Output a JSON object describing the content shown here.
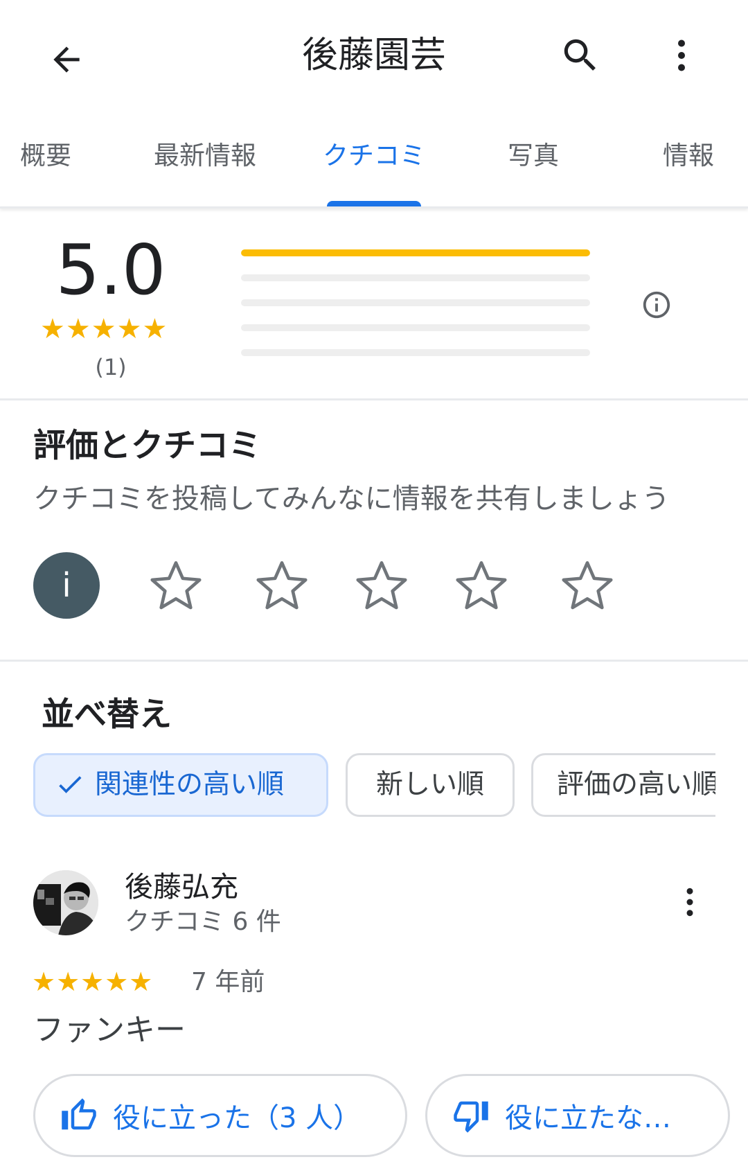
{
  "header": {
    "title": "後藤園芸",
    "back_icon": "arrow-back-icon",
    "search_icon": "search-icon",
    "more_icon": "more-vert-icon"
  },
  "tabs": [
    {
      "label": "概要",
      "active": false
    },
    {
      "label": "最新情報",
      "active": false
    },
    {
      "label": "クチコミ",
      "active": true
    },
    {
      "label": "写真",
      "active": false
    },
    {
      "label": "情報",
      "active": false
    }
  ],
  "rating_summary": {
    "average": "5.0",
    "stars": "★★★★★",
    "count": "(1)",
    "distribution": [
      {
        "stars": 5,
        "fraction": 1.0
      },
      {
        "stars": 4,
        "fraction": 0.0
      },
      {
        "stars": 3,
        "fraction": 0.0
      },
      {
        "stars": 2,
        "fraction": 0.0
      },
      {
        "stars": 1,
        "fraction": 0.0
      }
    ],
    "info_icon": "info-outline-icon"
  },
  "rate_review": {
    "title": "評価とクチコミ",
    "subtitle": "クチコミを投稿してみんなに情報を共有しましょう",
    "avatar_letter": "i",
    "empty_star_icon": "star-outline-icon"
  },
  "sort": {
    "title": "並べ替え",
    "options": [
      {
        "label": "関連性の高い順",
        "selected": true
      },
      {
        "label": "新しい順",
        "selected": false
      },
      {
        "label": "評価の高い順",
        "selected": false
      }
    ]
  },
  "review": {
    "author": "後藤弘充",
    "meta": "クチコミ 6 件",
    "stars": "★★★★★",
    "time": "7 年前",
    "text": "ファンキー",
    "helpful_label": "役に立った（3 人）",
    "not_helpful_label": "役に立たな…"
  },
  "colors": {
    "accent": "#1a73e8",
    "star": "#fbbc04",
    "text_primary": "#202124",
    "text_secondary": "#5f6368"
  }
}
